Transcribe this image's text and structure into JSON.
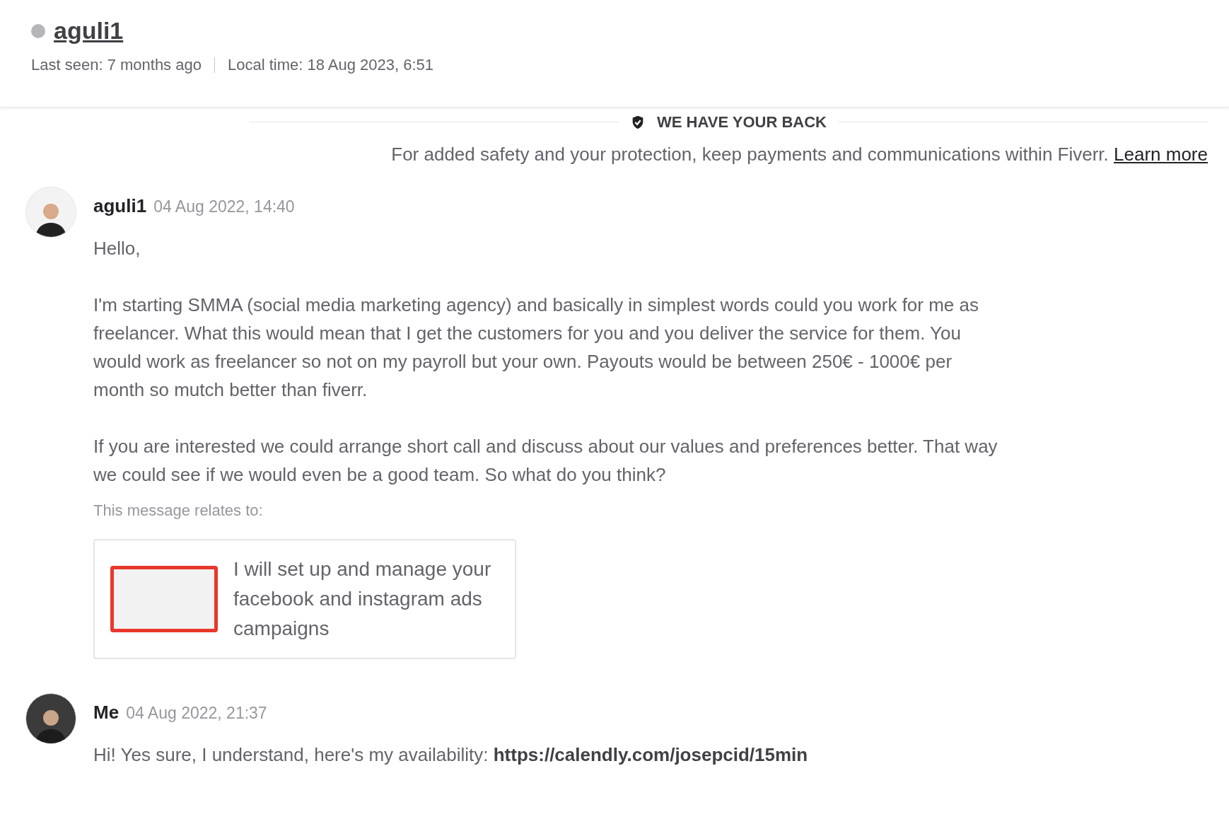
{
  "header": {
    "username": "aguli1",
    "online": false,
    "last_seen": "Last seen: 7 months ago",
    "local_time": "Local time: 18 Aug 2023, 6:51"
  },
  "safety_banner": {
    "title": "WE HAVE YOUR BACK",
    "text": "For added safety and your protection, keep payments and communications within Fiverr.",
    "link": "Learn more"
  },
  "messages": [
    {
      "sender": "aguli1",
      "time": "04 Aug 2022, 14:40",
      "paragraphs": [
        "Hello,",
        "I'm starting SMMA (social media marketing agency) and basically in simplest words could you work for me as freelancer. What this would mean that I get the customers for you and you deliver the service for them. You would work as freelancer so not on my payroll but your own. Payouts would be between 250€ - 1000€ per month so mutch better than fiverr.",
        "If you are interested we could arrange short call and discuss about our values and preferences better. That way we could see if we would even be a good team. So what do you think?"
      ],
      "relates_label": "This message relates to:",
      "gig": {
        "title": "I will set up and manage your facebook and instagram ads campaigns"
      }
    },
    {
      "sender": "Me",
      "time": "04 Aug 2022, 21:37",
      "paragraphs": [
        "Hi! Yes sure, I understand, here's my availability:"
      ],
      "link": "https://calendly.com/josepcid/15min"
    }
  ]
}
